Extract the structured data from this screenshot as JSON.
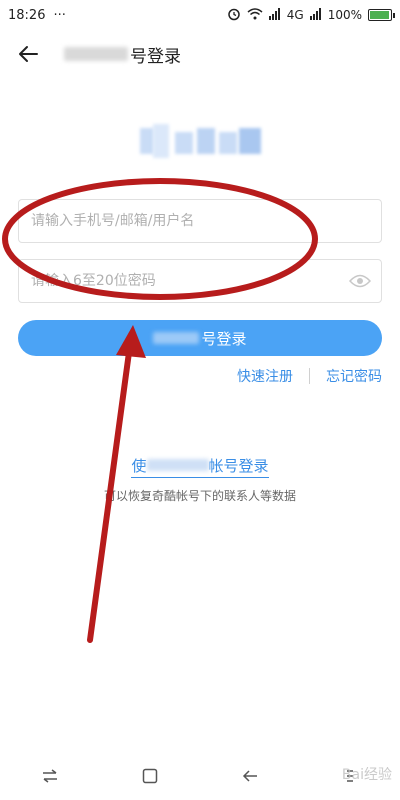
{
  "status_bar": {
    "time": "18:26",
    "dots": "···",
    "network": "4G",
    "battery_text": "100%"
  },
  "header": {
    "title_suffix": "号登录"
  },
  "form": {
    "username_placeholder": "请输入手机号/邮箱/用户名",
    "password_placeholder": "请输入6至20位密码",
    "login_suffix": "号登录"
  },
  "links": {
    "register": "快速注册",
    "forgot": "忘记密码"
  },
  "alt_login": {
    "prefix": "使",
    "suffix": "帐号登录",
    "hint": "可以恢复奇酷帐号下的联系人等数据"
  },
  "watermark": "Bai经验",
  "colors": {
    "accent": "#4ba3f5",
    "link": "#3a8ee6",
    "annotation": "#b71c1c"
  }
}
